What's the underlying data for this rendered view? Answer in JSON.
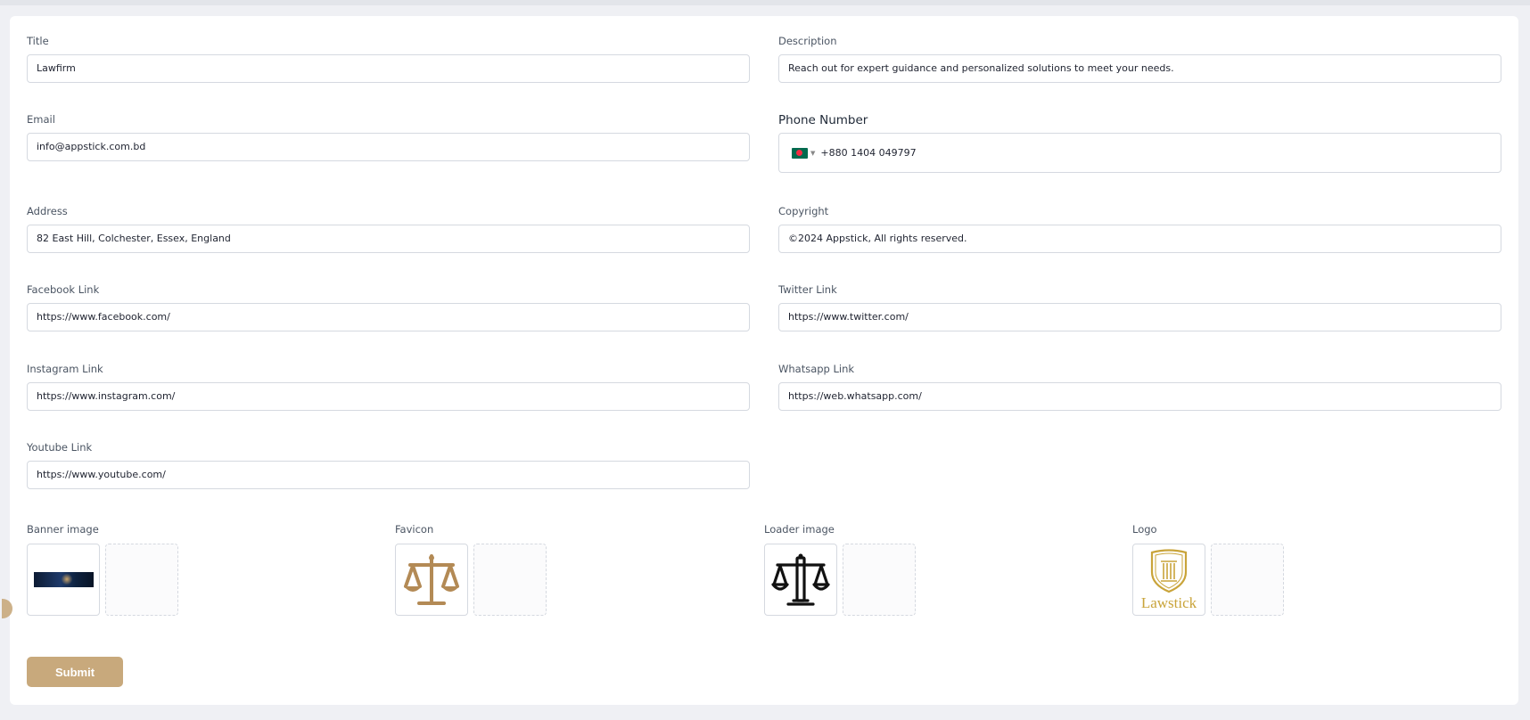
{
  "form": {
    "title": {
      "label": "Title",
      "value": "Lawfirm"
    },
    "description": {
      "label": "Description",
      "value": "Reach out for expert guidance and personalized solutions to meet your needs."
    },
    "email": {
      "label": "Email",
      "value": "info@appstick.com.bd"
    },
    "phone": {
      "label": "Phone Number",
      "value": "+880 1404 049797",
      "country": "BD"
    },
    "address": {
      "label": "Address",
      "value": "82 East Hill, Colchester, Essex, England"
    },
    "copyright": {
      "label": "Copyright",
      "value": "©2024 Appstick, All rights reserved."
    },
    "facebook": {
      "label": "Facebook Link",
      "value": "https://www.facebook.com/"
    },
    "twitter": {
      "label": "Twitter Link",
      "value": "https://www.twitter.com/"
    },
    "instagram": {
      "label": "Instagram Link",
      "value": "https://www.instagram.com/"
    },
    "whatsapp": {
      "label": "Whatsapp Link",
      "value": "https://web.whatsapp.com/"
    },
    "youtube": {
      "label": "Youtube Link",
      "value": "https://www.youtube.com/"
    }
  },
  "uploads": {
    "banner": {
      "label": "Banner image"
    },
    "favicon": {
      "label": "Favicon"
    },
    "loader": {
      "label": "Loader image"
    },
    "logo": {
      "label": "Logo",
      "logo_text": "Lawstick"
    }
  },
  "submit_label": "Submit",
  "colors": {
    "accent": "#c8a97c",
    "favicon_gold": "#b38a55",
    "logo_gold": "#c9a43a",
    "background": "#eff0f4"
  }
}
